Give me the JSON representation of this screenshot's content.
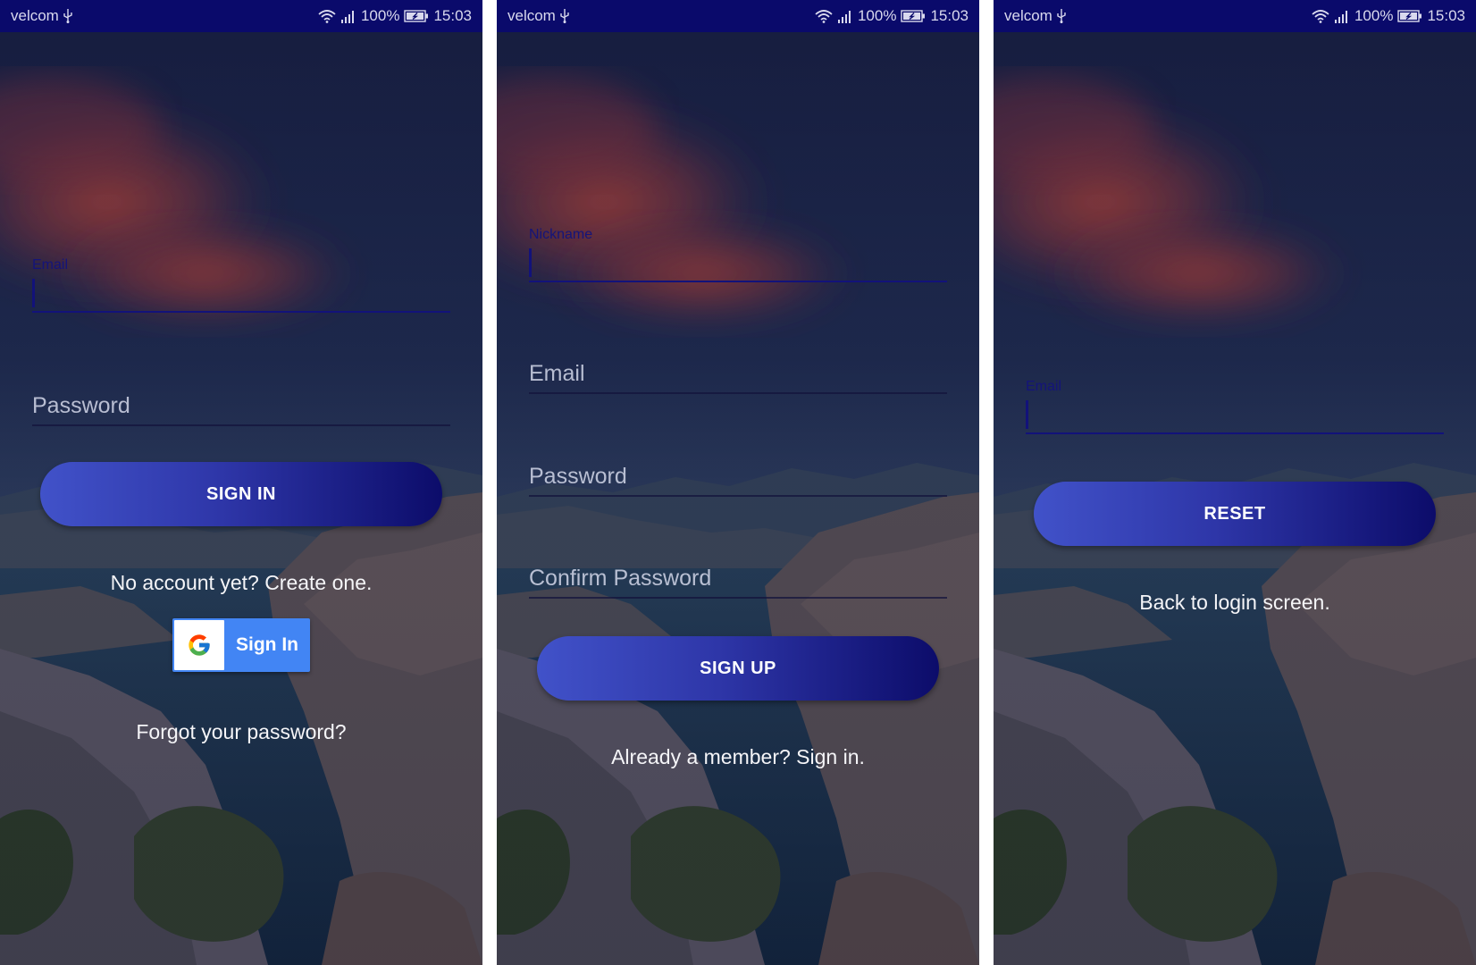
{
  "status_bar": {
    "carrier": "velcom",
    "battery": "100%",
    "time": "15:03"
  },
  "login": {
    "email_label": "Email",
    "password_hint": "Password",
    "sign_in_button": "SIGN IN",
    "create_account_link": "No account yet? Create one.",
    "google_sign_in": "Sign In",
    "forgot_password_link": "Forgot your password?"
  },
  "signup": {
    "nickname_label": "Nickname",
    "email_hint": "Email",
    "password_hint": "Password",
    "confirm_password_hint": "Confirm Password",
    "sign_up_button": "SIGN UP",
    "sign_in_link": "Already a member? Sign in."
  },
  "reset": {
    "email_label": "Email",
    "reset_button": "RESET",
    "back_link": "Back to login screen."
  },
  "colors": {
    "status_bar": "#0a0a6b",
    "accent": "#12127a",
    "button_gradient_start": "#4152c9",
    "button_gradient_end": "#0c0c6a",
    "google_blue": "#4285f4"
  }
}
